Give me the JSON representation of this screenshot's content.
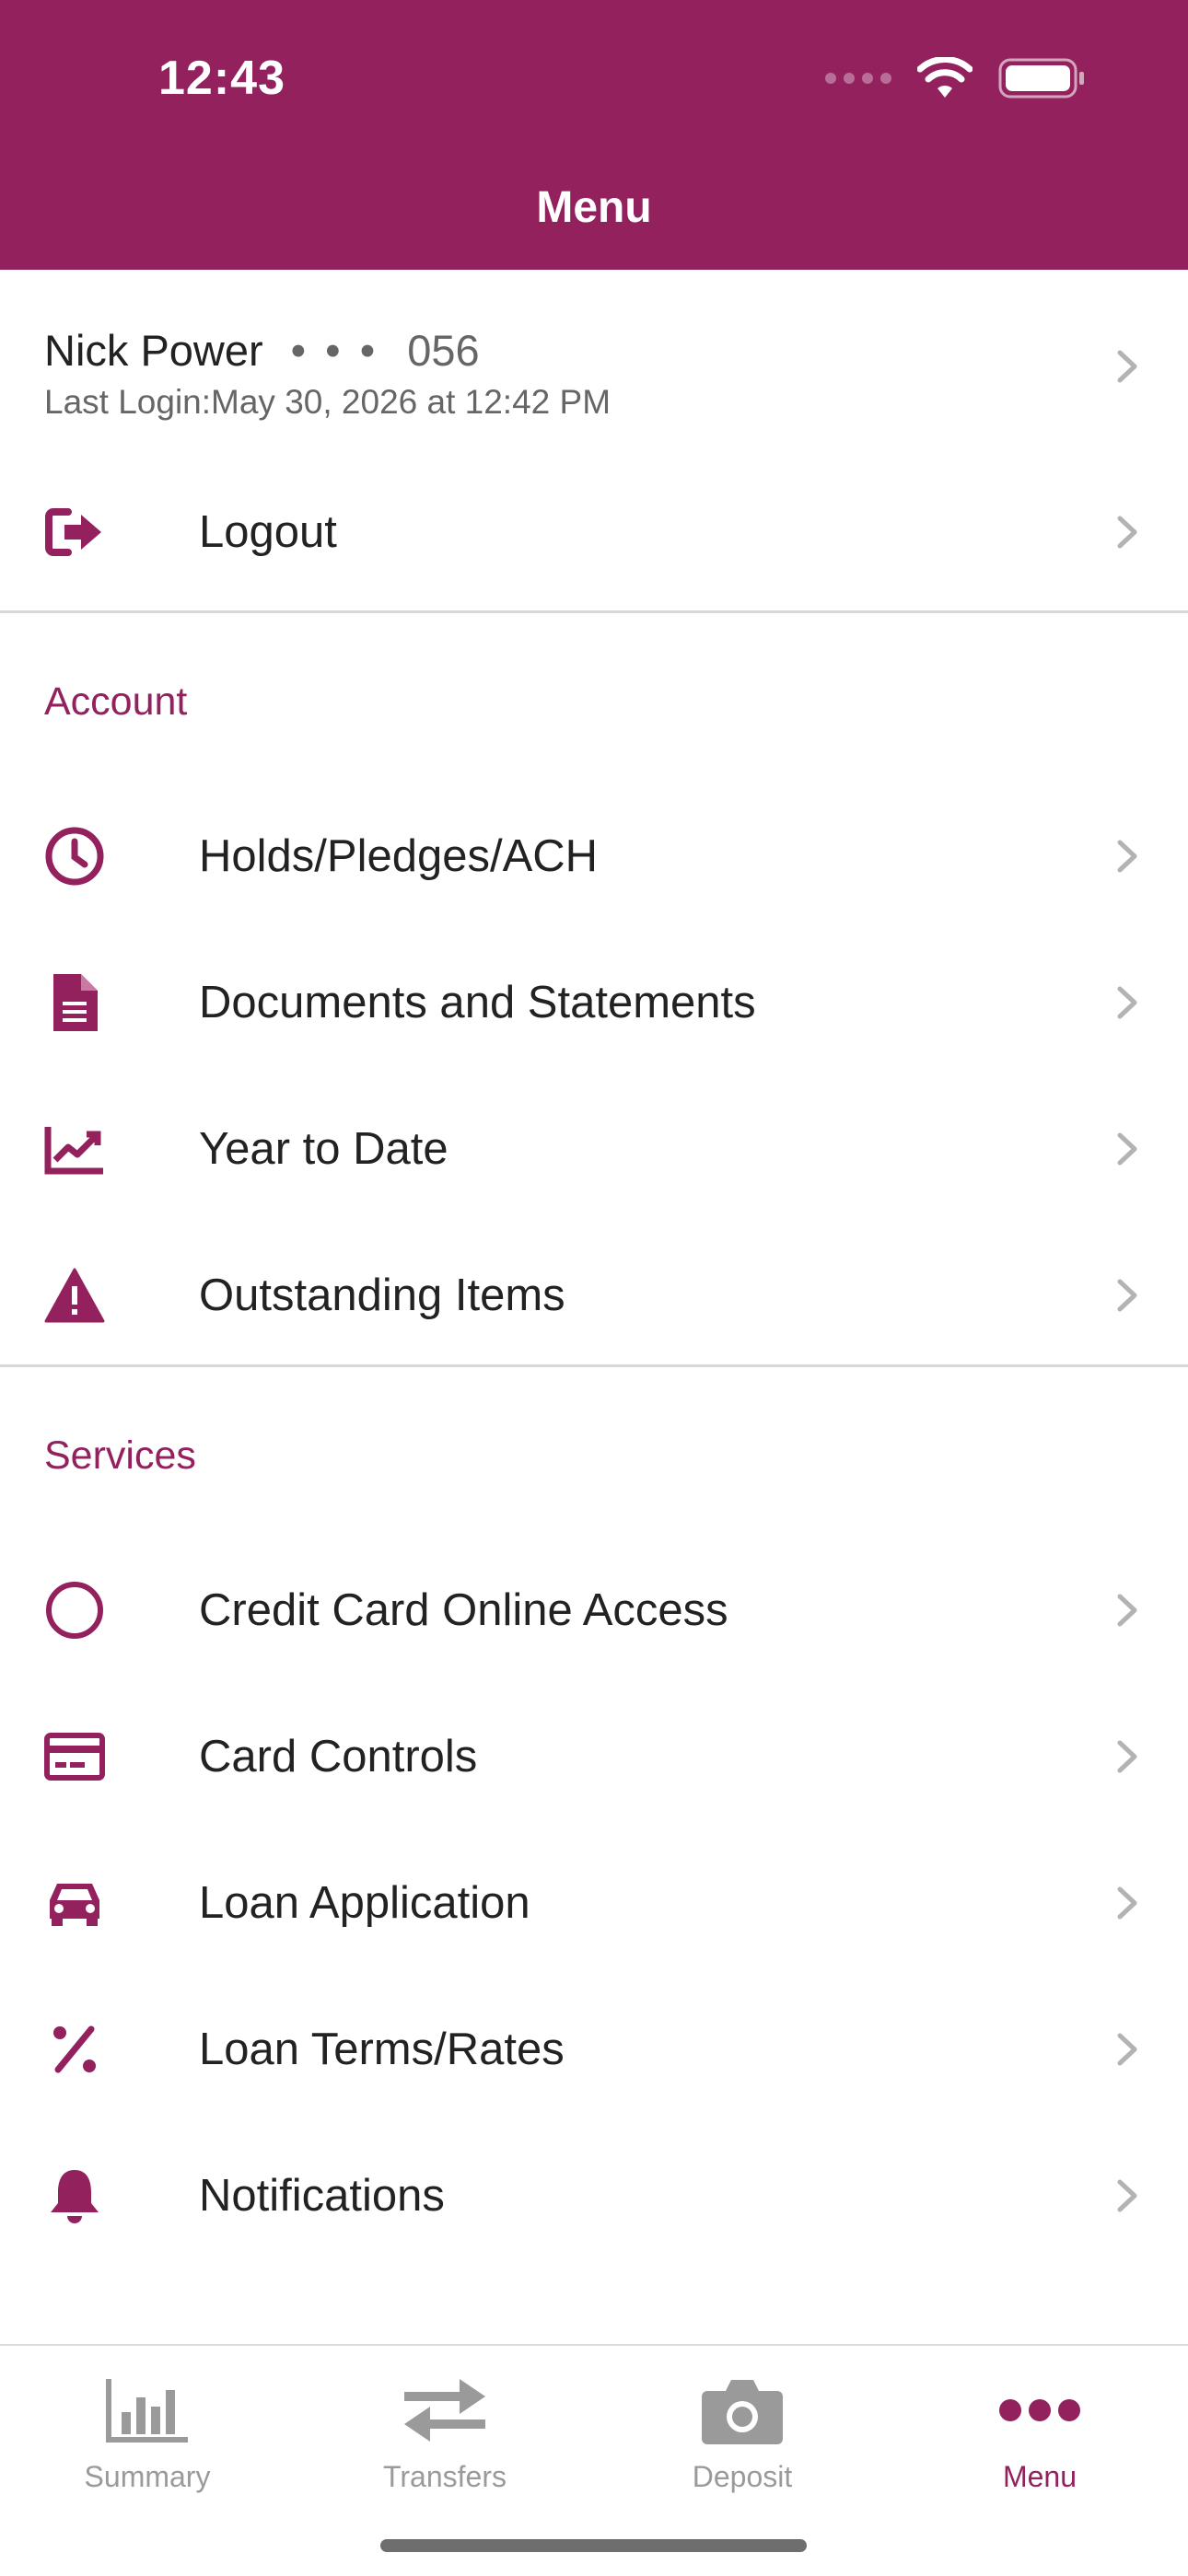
{
  "status_bar": {
    "time": "12:43"
  },
  "header": {
    "title": "Menu"
  },
  "profile": {
    "name": "Nick Power",
    "masked": "• • •",
    "account_suffix": "056",
    "last_login": "Last Login:May 30, 2026 at 12:42 PM"
  },
  "logout": {
    "label": "Logout",
    "icon": "logout-icon"
  },
  "account_section": {
    "title": "Account",
    "items": [
      {
        "label": "Holds/Pledges/ACH",
        "icon": "clock-icon"
      },
      {
        "label": "Documents and Statements",
        "icon": "document-icon"
      },
      {
        "label": "Year to Date",
        "icon": "chart-line-icon"
      },
      {
        "label": "Outstanding Items",
        "icon": "warning-icon"
      }
    ]
  },
  "services_section": {
    "title": "Services",
    "items": [
      {
        "label": "Credit Card Online Access",
        "icon": "circle-icon"
      },
      {
        "label": "Card Controls",
        "icon": "credit-card-icon"
      },
      {
        "label": "Loan Application",
        "icon": "car-icon"
      },
      {
        "label": "Loan Terms/Rates",
        "icon": "percent-icon"
      },
      {
        "label": "Notifications",
        "icon": "bell-icon"
      }
    ]
  },
  "tabbar": {
    "tabs": [
      {
        "label": "Summary",
        "icon": "bar-chart-icon"
      },
      {
        "label": "Transfers",
        "icon": "transfer-arrows-icon"
      },
      {
        "label": "Deposit",
        "icon": "camera-icon"
      },
      {
        "label": "Menu",
        "icon": "more-dots-icon"
      }
    ],
    "active": "Menu"
  },
  "colors": {
    "brand": "#93215E",
    "text": "#222222",
    "muted": "#666666",
    "inactive_tab": "#9a9a9a"
  }
}
